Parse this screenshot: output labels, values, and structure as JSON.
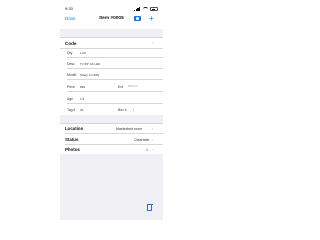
{
  "status_bar": {
    "time": "9:33"
  },
  "nav": {
    "done_label": "Done",
    "title": "Item #0005",
    "camera_icon": "camera-icon",
    "add_icon": "plus-icon",
    "add_glyph": "+"
  },
  "code": {
    "label": "Code"
  },
  "fields": [
    {
      "label": "Qty",
      "value": "1.00"
    },
    {
      "label": "Desc",
      "value": "TV 65\" 4K LED"
    },
    {
      "label": "Model",
      "value": "Sharp LC-65N"
    },
    {
      "label": "Price",
      "value": "899"
    },
    {
      "label": "Age",
      "value": "1.5"
    },
    {
      "label": "Tag #",
      "value": "32"
    }
  ],
  "ext": {
    "label": "Ext",
    "value": "$899.00"
  },
  "box": {
    "label": "Box #"
  },
  "location": {
    "label": "Location",
    "value": "Masterbed room"
  },
  "status": {
    "label": "Status",
    "value": "Clearable"
  },
  "photos": {
    "label": "Photos",
    "value": "1"
  },
  "chevron": "›"
}
